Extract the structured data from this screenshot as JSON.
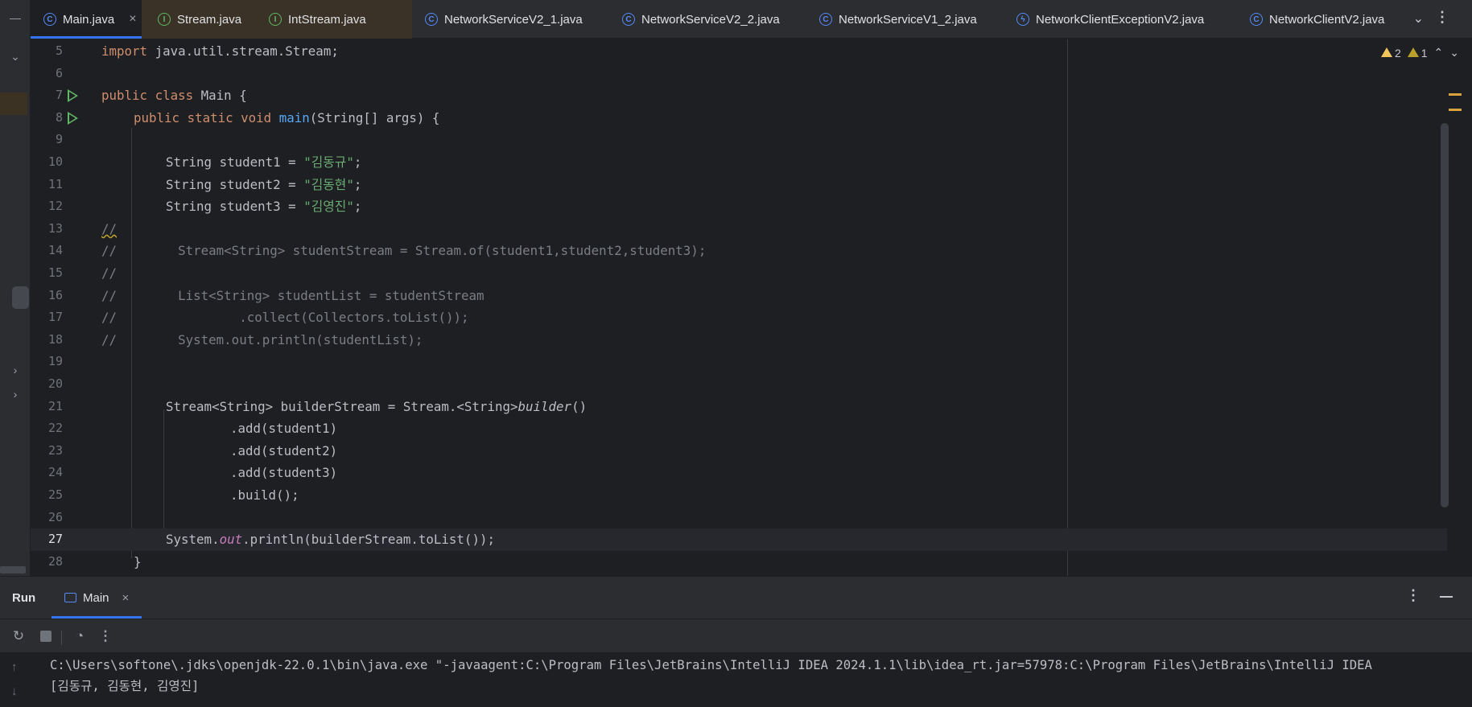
{
  "tabs": [
    {
      "label": "Main.java",
      "icon": "class-icon",
      "active": true,
      "closable": true
    },
    {
      "label": "Stream.java",
      "icon": "interface-icon",
      "active": false
    },
    {
      "label": "IntStream.java",
      "icon": "interface-icon",
      "active": false
    },
    {
      "label": "NetworkServiceV2_1.java",
      "icon": "class-icon",
      "active": false
    },
    {
      "label": "NetworkServiceV2_2.java",
      "icon": "class-icon",
      "active": false
    },
    {
      "label": "NetworkServiceV1_2.java",
      "icon": "class-icon",
      "active": false
    },
    {
      "label": "NetworkClientExceptionV2.java",
      "icon": "exception-icon",
      "active": false
    },
    {
      "label": "NetworkClientV2.java",
      "icon": "class-icon",
      "active": false
    }
  ],
  "inspections": {
    "warnings": "2",
    "weak_warnings": "1"
  },
  "editor": {
    "current_line": "27",
    "lines": [
      {
        "n": "5"
      },
      {
        "n": "6"
      },
      {
        "n": "7"
      },
      {
        "n": "8"
      },
      {
        "n": "9"
      },
      {
        "n": "10"
      },
      {
        "n": "11"
      },
      {
        "n": "12"
      },
      {
        "n": "13"
      },
      {
        "n": "14"
      },
      {
        "n": "15"
      },
      {
        "n": "16"
      },
      {
        "n": "17"
      },
      {
        "n": "18"
      },
      {
        "n": "19"
      },
      {
        "n": "20"
      },
      {
        "n": "21"
      },
      {
        "n": "22"
      },
      {
        "n": "23"
      },
      {
        "n": "24"
      },
      {
        "n": "25"
      },
      {
        "n": "26"
      },
      {
        "n": "27"
      },
      {
        "n": "28"
      }
    ],
    "code": {
      "l5_kw": "import",
      "l5_rest": " java.util.stream.Stream;",
      "l7_kw": "public class",
      "l7_rest": " Main {",
      "l8_kw": "public static void",
      "l8_fn": "main",
      "l8_rest": "(String[] args) {",
      "l10_pre": "String student1 = ",
      "l10_str": "\"김동규\"",
      "l11_pre": "String student2 = ",
      "l11_str": "\"김동현\"",
      "l12_pre": "String student3 = ",
      "l12_str": "\"김영진\"",
      "semi": ";",
      "l13": "//",
      "l14": "//        Stream<String> studentStream = Stream.of(student1,student2,student3);",
      "l15": "//",
      "l16": "//        List<String> studentList = studentStream",
      "l17": "//                .collect(Collectors.toList());",
      "l18": "//        System.out.println(studentList);",
      "l21_pre": "Stream<String> builderStream = Stream.<String>",
      "l21_it": "builder",
      "l21_post": "()",
      "l22": ".add(student1)",
      "l23": ".add(student2)",
      "l24": ".add(student3)",
      "l25": ".build();",
      "l27_pre": "System.",
      "l27_fld": "out",
      "l27_post": ".println(builderStream.toList());",
      "l28": "}"
    }
  },
  "run_panel": {
    "title": "Run",
    "tab_label": "Main",
    "console": [
      "C:\\Users\\softone\\.jdks\\openjdk-22.0.1\\bin\\java.exe \"-javaagent:C:\\Program Files\\JetBrains\\IntelliJ IDEA 2024.1.1\\lib\\idea_rt.jar=57978:C:\\Program Files\\JetBrains\\IntelliJ IDEA",
      "[김동규, 김동현, 김영진]"
    ]
  },
  "colors": {
    "background": "#1e1f22",
    "panel": "#2b2d30",
    "accent": "#3574f0",
    "keyword": "#cf8e6d",
    "string": "#6aab73",
    "function": "#56a8f5",
    "comment": "#7a7e85"
  }
}
